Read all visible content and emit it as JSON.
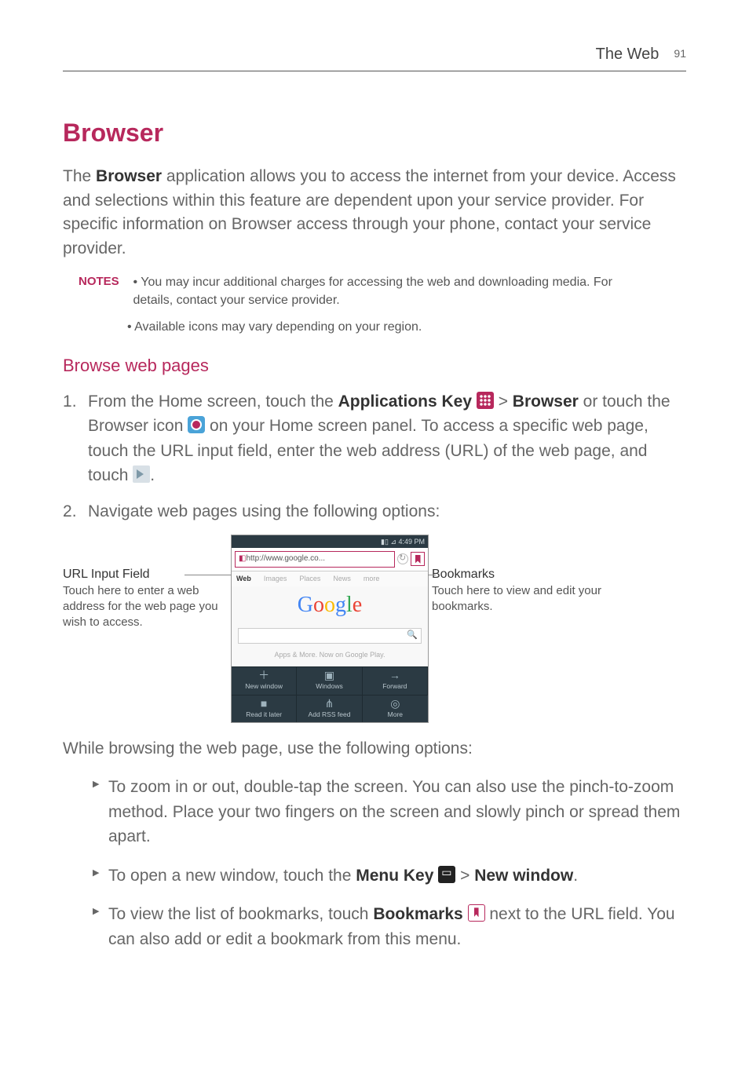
{
  "header": {
    "section": "The Web",
    "page_number": "91"
  },
  "title": "Browser",
  "intro": {
    "pre": "The ",
    "bold": "Browser",
    "post": " application allows you to access the internet from your device. Access and selections within this feature are dependent upon your service provider. For specific information on Browser access through your phone, contact your service provider."
  },
  "notes": {
    "label": "NOTES",
    "bullet": "•",
    "items": [
      "You may incur additional charges for accessing the web and downloading media. For details, contact your service provider.",
      "Available icons may vary depending on your region."
    ]
  },
  "subhead": "Browse web pages",
  "steps": {
    "s1": {
      "a": "From the Home screen, touch the ",
      "b": "Applications Key",
      "c": " > ",
      "d": "Browser",
      "e": " or touch the Browser icon ",
      "f": " on your Home screen panel. To access a specific web page,  touch the URL input field, enter the web address (URL) of the web page, and touch ",
      "g": "."
    },
    "s2": "Navigate web pages using the following options:"
  },
  "callout_left": {
    "title": "URL Input Field",
    "body": "Touch here to enter a web address for the web page you wish to access."
  },
  "callout_right": {
    "title": "Bookmarks",
    "body": "Touch here to view and edit your bookmarks."
  },
  "phone": {
    "status_time": "4:49 PM",
    "url": "http://www.google.co...",
    "tabs": [
      "Web",
      "Images",
      "Places",
      "News",
      "more"
    ],
    "logo_letters": [
      "G",
      "o",
      "o",
      "g",
      "l",
      "e"
    ],
    "apps_line": "Apps & More. Now on Google Play.",
    "menu_top": [
      {
        "icon": "＋",
        "label": "New window"
      },
      {
        "icon": "▣",
        "label": "Windows"
      },
      {
        "icon": "→",
        "label": "Forward"
      }
    ],
    "menu_bottom": [
      {
        "icon": "■",
        "label": "Read it later"
      },
      {
        "icon": "⋔",
        "label": "Add RSS feed"
      },
      {
        "icon": "◎",
        "label": "More"
      }
    ]
  },
  "post_figure": "While browsing the web page, use the following options:",
  "options": {
    "o1": "To zoom in or out, double-tap the screen. You can also use the pinch-to-zoom method. Place your two fingers on the screen and slowly pinch or spread them apart.",
    "o2": {
      "a": "To open a new window, touch the ",
      "b": "Menu Key",
      "c": "  > ",
      "d": "New window",
      "e": "."
    },
    "o3": {
      "a": "To view the list of bookmarks, touch ",
      "b": "Bookmarks",
      "c": " next to the URL field. You can also add or edit a bookmark from this menu."
    }
  }
}
